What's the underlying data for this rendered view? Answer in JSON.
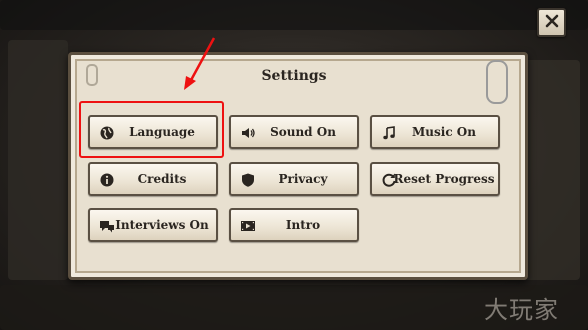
{
  "settings": {
    "title": "Settings",
    "buttons": [
      {
        "label": "Language",
        "icon": "globe-icon"
      },
      {
        "label": "Sound On",
        "icon": "speaker-icon"
      },
      {
        "label": "Music On",
        "icon": "music-note-icon"
      },
      {
        "label": "Credits",
        "icon": "info-icon"
      },
      {
        "label": "Privacy",
        "icon": "shield-icon"
      },
      {
        "label": "Reset Progress",
        "icon": "reset-icon"
      },
      {
        "label": "Interviews On",
        "icon": "interview-icon"
      },
      {
        "label": "Intro",
        "icon": "film-icon"
      }
    ]
  },
  "close": {
    "icon": "close-icon"
  },
  "annotation": {
    "highlight_color": "#ee1111",
    "highlighted": "Language"
  },
  "watermark": "大玩家"
}
